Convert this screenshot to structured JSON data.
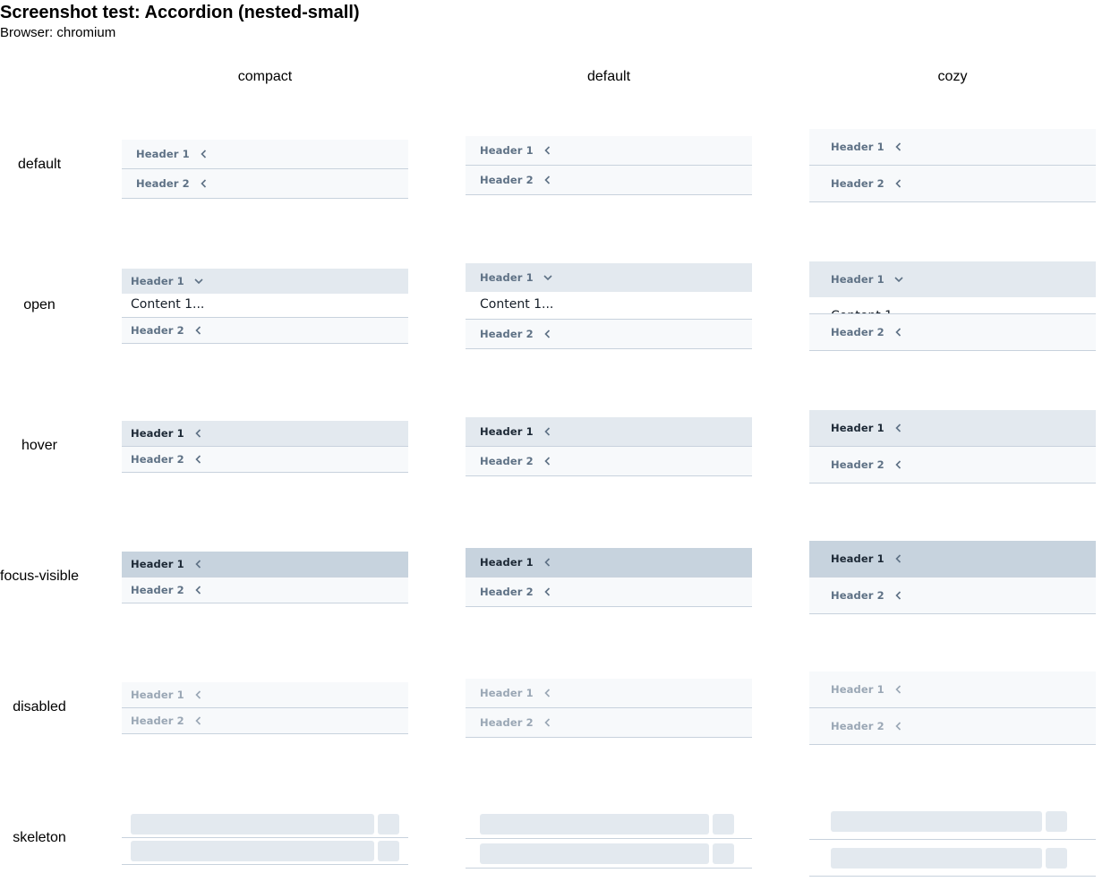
{
  "page": {
    "title": "Screenshot test: Accordion (nested-small)",
    "subtitle": "Browser: chromium"
  },
  "columns": [
    "compact",
    "default",
    "cozy"
  ],
  "rows": [
    "default",
    "open",
    "hover",
    "focus-visible",
    "disabled",
    "skeleton"
  ],
  "accordion": {
    "header1": "Header 1",
    "header2": "Header 2",
    "content1": "Content 1..."
  },
  "icons": {
    "collapsed": "chevron-left-icon",
    "expanded": "chevron-down-icon"
  },
  "colors": {
    "header_bg": "#f7f9fb",
    "header_hover_bg": "#e3e9ef",
    "header_focus_bg": "#c7d3de",
    "divider": "#c8d2dd",
    "text_muted": "#5e7185",
    "skeleton": "#e3e9ef"
  }
}
